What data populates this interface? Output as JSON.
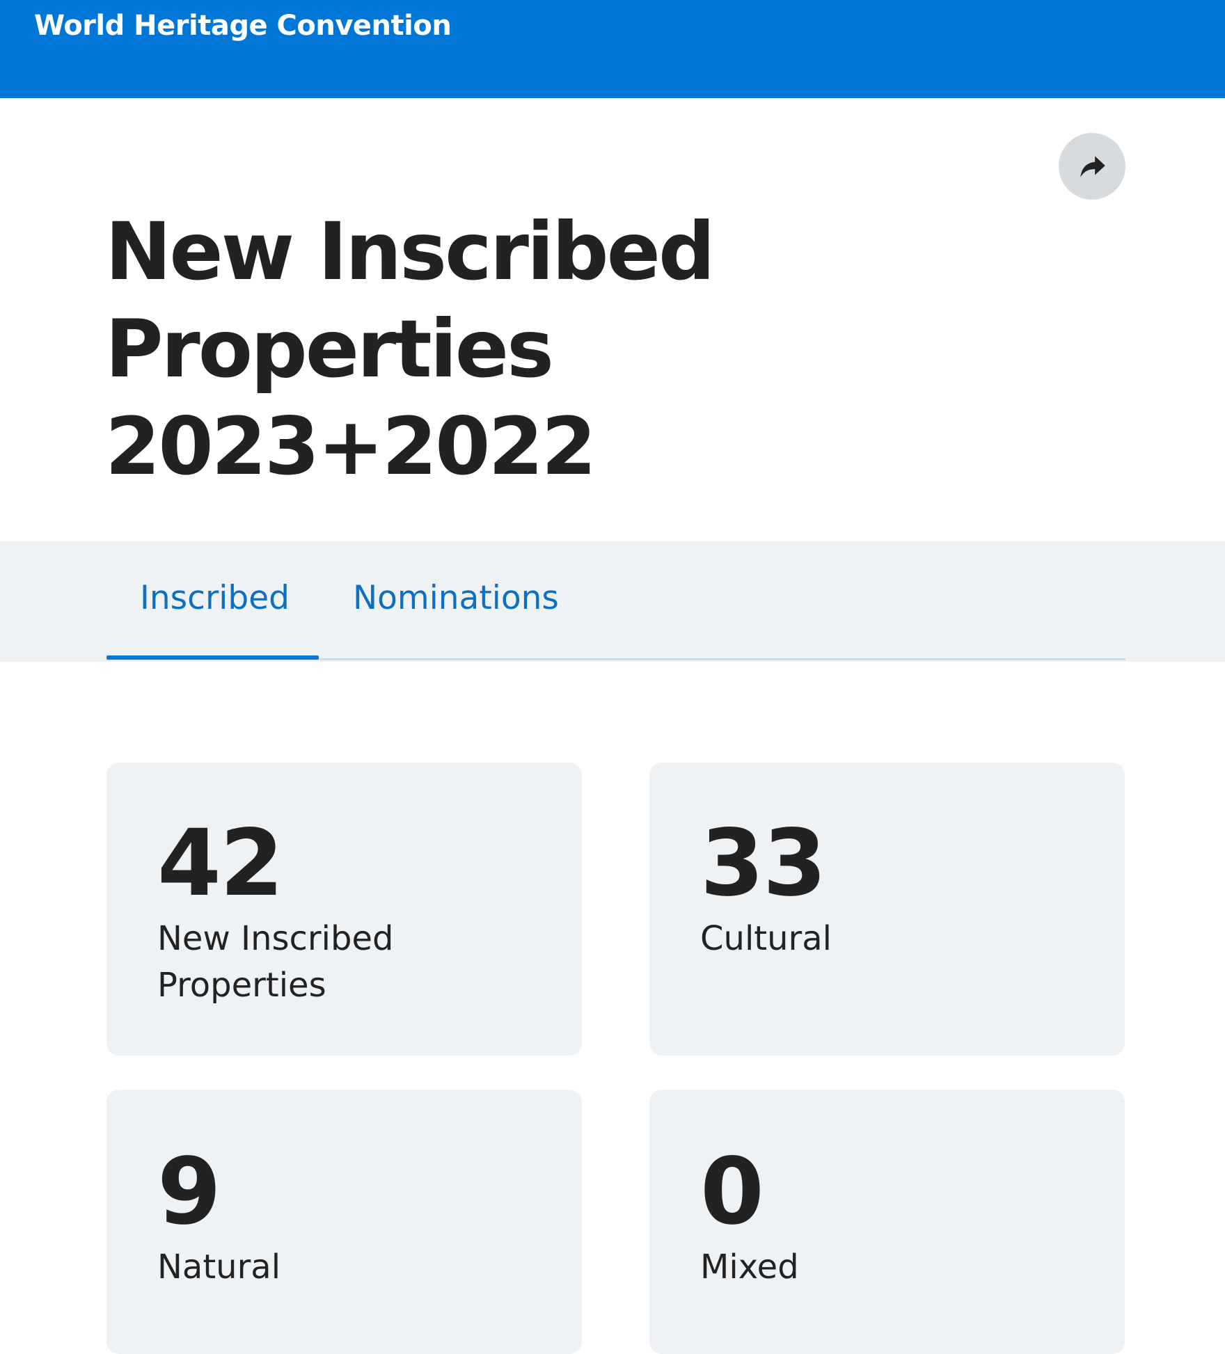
{
  "header": {
    "site_title": "World Heritage Convention",
    "background_color": "#0077d6"
  },
  "share": {
    "icon": "share-arrow-icon"
  },
  "page": {
    "title_lines": [
      "New Inscribed",
      "Properties",
      "2023+2022"
    ]
  },
  "tabs": [
    {
      "label": "Inscribed",
      "active": true
    },
    {
      "label": "Nominations",
      "active": false
    }
  ],
  "stats": [
    {
      "value": "42",
      "label": "New Inscribed Properties"
    },
    {
      "value": "33",
      "label": "Cultural"
    },
    {
      "value": "9",
      "label": "Natural"
    },
    {
      "value": "0",
      "label": "Mixed"
    }
  ],
  "colors": {
    "accent": "#0c78d6",
    "card_background": "#eff2f5",
    "text": "#222222"
  }
}
